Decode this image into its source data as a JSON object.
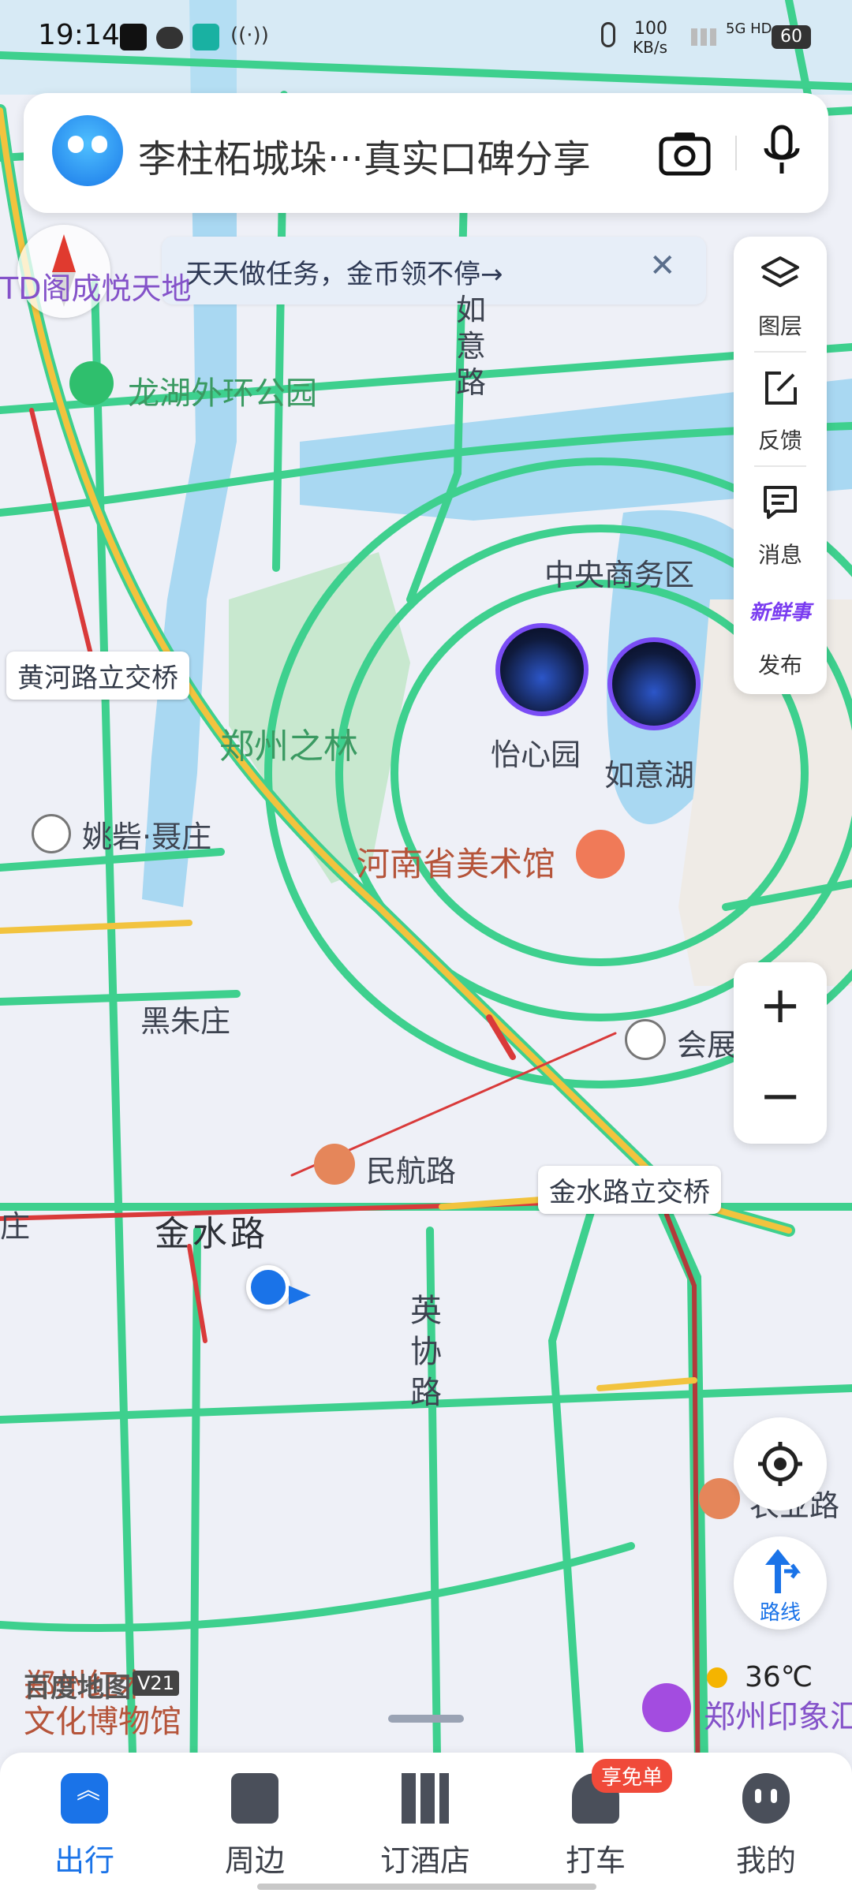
{
  "status_bar": {
    "time": "19:14",
    "net_speed_value": "100",
    "net_speed_unit": "KB/s",
    "network_type": "5G HD",
    "battery": "60"
  },
  "search": {
    "text": "李柱柘城垛···真实口碑分享"
  },
  "task_banner": {
    "text": "天天做任务，金币领不停→"
  },
  "tools": {
    "layers": "图层",
    "feedback": "反馈",
    "messages": "消息",
    "publish": "发布",
    "publish_logo_text": "新鲜事"
  },
  "map_labels": {
    "top_left_poi": "TD阁成悦天地",
    "longhu_park": "龙湖外环公园",
    "road_vertical_top": "如意路",
    "cbd": "中央商务区",
    "huanghe_bridge": "黄河路立交桥",
    "zhengzhou_forest": "郑州之林",
    "yixin_garden": "怡心园",
    "ruyi_lake": "如意湖",
    "yaobo_niezhuang": "姚砦·聂庄",
    "henan_art_museum": "河南省美术馆",
    "heizhu_zhuang": "黑朱庄",
    "exhibition": "会展",
    "minhang_road": "民航路",
    "jinshui_bridge": "金水路立交桥",
    "left_edge_zhuang": "庄",
    "jinshui_road": "金水路",
    "yingxie_road": "英协路",
    "bottom_right_road": "农业路",
    "bottom_left_museum_1": "郑州红木",
    "bottom_left_museum_2": "文化博物馆",
    "impression": "郑州印象汇",
    "baidu_logo": "百度地图",
    "baidu_version": "V21",
    "temperature": "36℃"
  },
  "controls": {
    "zoom_in": "+",
    "zoom_out": "−",
    "route": "路线"
  },
  "tabs": [
    {
      "label": "出行",
      "active": true
    },
    {
      "label": "周边",
      "active": false
    },
    {
      "label": "订酒店",
      "active": false
    },
    {
      "label": "打车",
      "active": false,
      "badge": "享免单"
    },
    {
      "label": "我的",
      "active": false
    }
  ],
  "colors": {
    "accent": "#1a73e8",
    "road_green": "#3ed08e",
    "road_yellow": "#f2c33e",
    "road_red": "#d93a3a",
    "water": "#a9d8f2",
    "park": "#c8e8cf"
  }
}
